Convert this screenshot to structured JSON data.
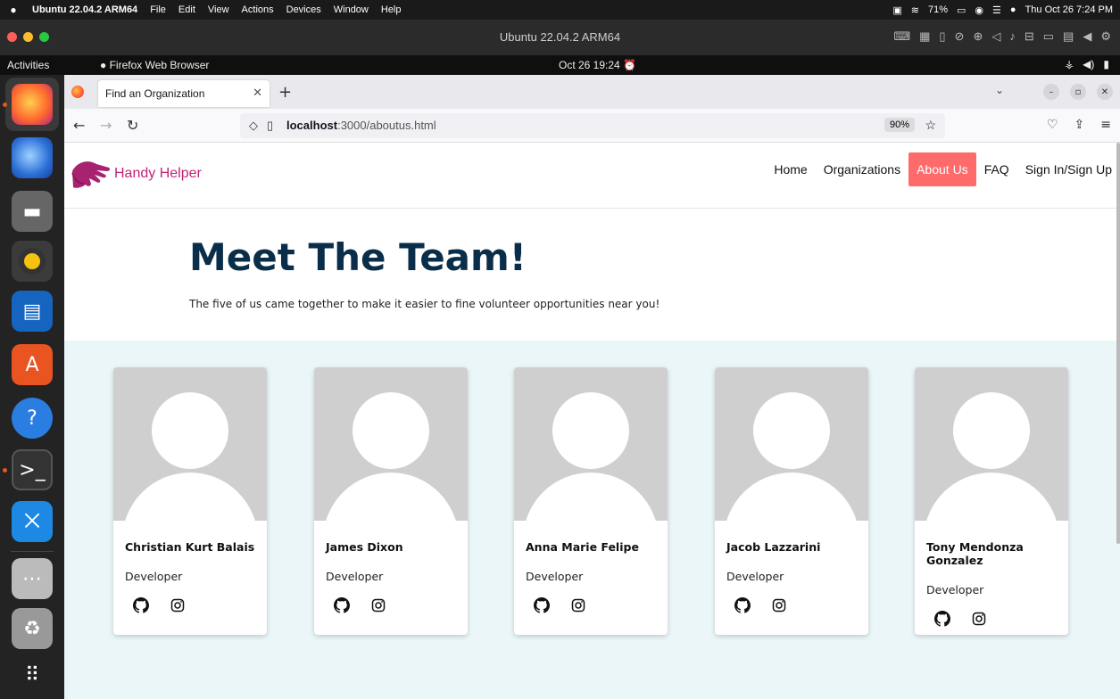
{
  "mac": {
    "app_name": "Ubuntu 22.04.2 ARM64",
    "menus": [
      "File",
      "Edit",
      "View",
      "Actions",
      "Devices",
      "Window",
      "Help"
    ],
    "battery": "71%",
    "datetime": "Thu Oct 26  7:24 PM"
  },
  "vm": {
    "title": "Ubuntu 22.04.2 ARM64"
  },
  "ubuntu": {
    "activities": "Activities",
    "app": "Firefox Web Browser",
    "clock": "Oct 26  19:24"
  },
  "browser": {
    "tab_title": "Find an Organization",
    "url_host": "localhost",
    "url_rest": ":3000/aboutus.html",
    "zoom": "90%"
  },
  "site": {
    "brand": "Handy Helper",
    "nav": {
      "home": "Home",
      "organizations": "Organizations",
      "about": "About Us",
      "faq": "FAQ",
      "sign": "Sign In/Sign Up"
    },
    "hero_title": "Meet The Team!",
    "hero_sub": "The five of us came together to make it easier to fine volunteer opportunities near you!",
    "team": [
      {
        "name": "Christian Kurt Balais",
        "role": "Developer"
      },
      {
        "name": "James Dixon",
        "role": "Developer"
      },
      {
        "name": "Anna Marie Felipe",
        "role": "Developer"
      },
      {
        "name": "Jacob Lazzarini",
        "role": "Developer"
      },
      {
        "name": "Tony Mendonza Gonzalez",
        "role": "Developer"
      }
    ]
  },
  "colors": {
    "brand": "#c2237a",
    "active_nav": "#ff6b6b",
    "title": "#0a2e49",
    "section_bg": "#eaf6f8"
  },
  "icons": {
    "social": [
      "github-icon",
      "instagram-icon"
    ]
  }
}
